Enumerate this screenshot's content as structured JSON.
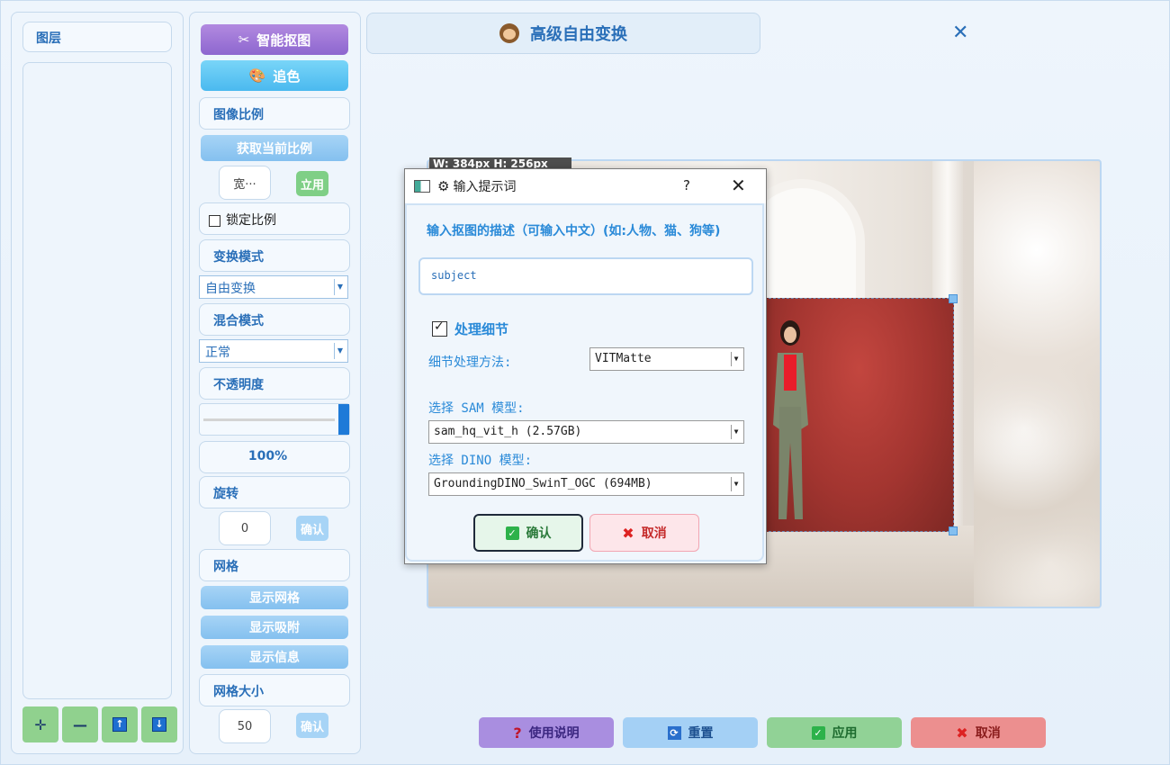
{
  "layers": {
    "title": "图层",
    "buttons": [
      "✛",
      "—",
      "↑",
      "↓"
    ]
  },
  "tools": {
    "smart_cutout": "智能抠图",
    "recolor": "追色",
    "aspect_section": "图像比例",
    "get_current_ratio": "获取当前比例",
    "width_placeholder": "宽···",
    "apply_small": "立用",
    "lock_ratio": "锁定比例",
    "transform_mode_section": "变换模式",
    "transform_mode_value": "自由变换",
    "blend_mode_section": "混合模式",
    "blend_mode_value": "正常",
    "opacity_section": "不透明度",
    "opacity_percent": 100,
    "opacity_value": "100%",
    "rotate_section": "旋转",
    "rotate_value": "0",
    "confirm": "确认",
    "grid_section": "网格",
    "show_grid": "显示网格",
    "show_snap": "显示吸附",
    "show_info": "显示信息",
    "grid_size_section": "网格大小",
    "grid_size_value": "50"
  },
  "header": {
    "title": "高级自由变换"
  },
  "canvas": {
    "size_label": "W: 384px H: 256px"
  },
  "dialog": {
    "title": "输入提示词",
    "help": "?",
    "prompt_label": "输入抠图的描述（可输入中文）(如:人物、猫、狗等)",
    "prompt_value": "subject",
    "process_detail": "处理细节",
    "detail_method_label": "细节处理方法:",
    "detail_method_value": "VITMatte",
    "sam_label": "选择 SAM 模型:",
    "sam_value": "sam_hq_vit_h (2.57GB)",
    "dino_label": "选择 DINO 模型:",
    "dino_value": "GroundingDINO_SwinT_OGC (694MB)",
    "ok": "确认",
    "cancel": "取消"
  },
  "footer": {
    "help": "使用说明",
    "reset": "重置",
    "apply": "应用",
    "cancel": "取消"
  }
}
